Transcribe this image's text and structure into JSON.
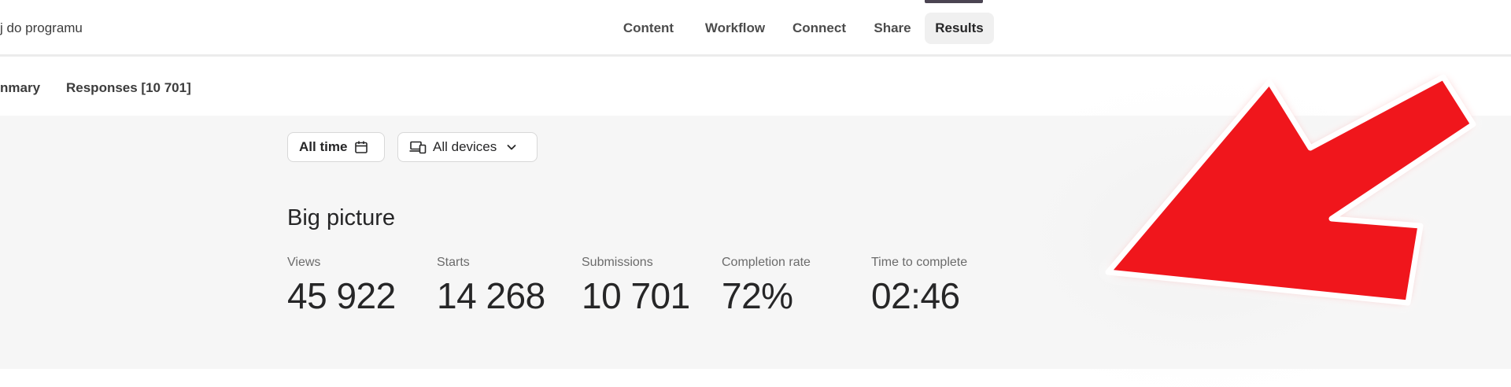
{
  "header": {
    "back_link": "j do programu",
    "nav": [
      {
        "label": "Content"
      },
      {
        "label": "Workflow"
      },
      {
        "label": "Connect"
      },
      {
        "label": "Share"
      },
      {
        "label": "Results",
        "active": true
      }
    ]
  },
  "subnav": {
    "tabs": [
      {
        "label": "nmary"
      },
      {
        "label": "Responses [10 701]"
      }
    ]
  },
  "filters": {
    "time": {
      "label": "All time",
      "icon": "calendar-icon"
    },
    "devices": {
      "label": "All devices",
      "icon": "devices-icon"
    }
  },
  "big_picture": {
    "title": "Big picture",
    "metrics": [
      {
        "label": "Views",
        "value": "45 922"
      },
      {
        "label": "Starts",
        "value": "14 268"
      },
      {
        "label": "Submissions",
        "value": "10 701"
      },
      {
        "label": "Completion rate",
        "value": "72%"
      },
      {
        "label": "Time to complete",
        "value": "02:46"
      }
    ]
  },
  "annotation": {
    "icon": "red-arrow-icon",
    "color": "#f0121f"
  },
  "colors": {
    "content_bg": "#f6f6f6",
    "active_tab_bg": "#f0f0f0",
    "text": "#262627"
  }
}
